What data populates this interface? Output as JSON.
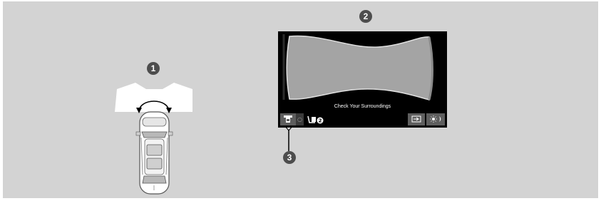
{
  "callouts": [
    "1",
    "2",
    "3"
  ],
  "screen": {
    "caption": "Check Your Surroundings",
    "view_button_1_icon": "top-down-view-icon",
    "view_button_2_icon": "rear-view-icon",
    "exit_button_icon": "exit-arrow-icon",
    "brightness_button_icon": "brightness-icon"
  },
  "vehicle": {
    "icon": "car-top-view-icon",
    "swing_indicator_icon": "curved-double-arrow-icon"
  }
}
